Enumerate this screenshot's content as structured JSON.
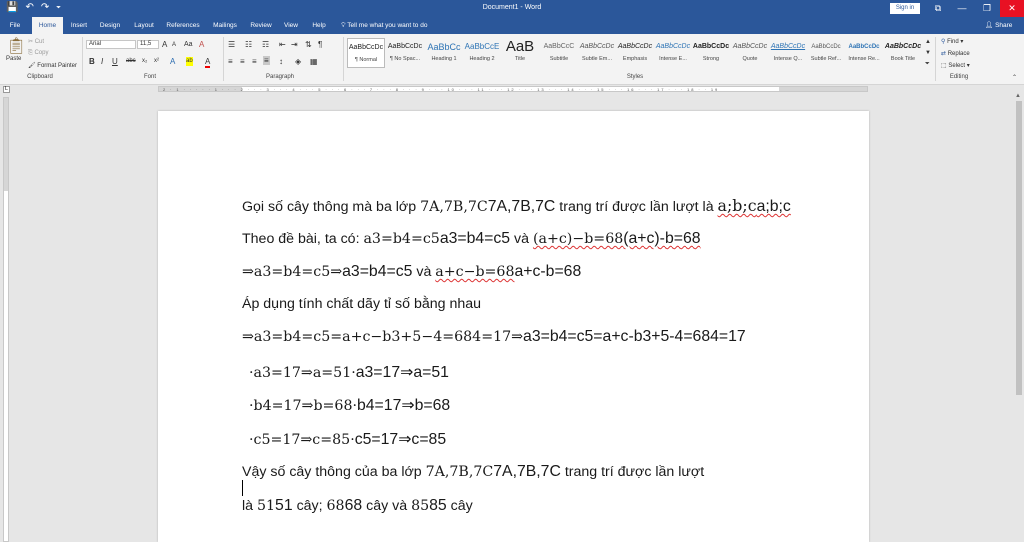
{
  "window": {
    "title": "Document1 - Word",
    "sign_in": "Sign in",
    "share": "Share",
    "qat": [
      "💾",
      "↶",
      "↷",
      "⏷"
    ],
    "controls": [
      "⧉",
      "—",
      "❐",
      "✕"
    ]
  },
  "tabs": [
    "File",
    "Home",
    "Insert",
    "Design",
    "Layout",
    "References",
    "Mailings",
    "Review",
    "View",
    "Help"
  ],
  "tell_me": "Tell me what you want to do",
  "ribbon": {
    "clipboard": {
      "paste": "Paste",
      "cut": "Cut",
      "copy": "Copy",
      "format_painter": "Format Painter",
      "label": "Clipboard"
    },
    "font": {
      "name": "Arial",
      "size": "11,5",
      "label": "Font",
      "grow": "A",
      "shrink": "A",
      "case": "Aa",
      "clear": "A",
      "bold": "B",
      "italic": "I",
      "underline": "U",
      "strike": "abc",
      "sub": "x₂",
      "sup": "x²",
      "effects": "A",
      "highlight": "ab",
      "color": "A"
    },
    "paragraph": {
      "label": "Paragraph",
      "pilcrow": "¶"
    },
    "styles": {
      "label": "Styles",
      "items": [
        {
          "preview": "AaBbCcDc",
          "name": "¶ Normal"
        },
        {
          "preview": "AaBbCcDc",
          "name": "¶ No Spac..."
        },
        {
          "preview": "AaBbCc",
          "name": "Heading 1"
        },
        {
          "preview": "AaBbCcE",
          "name": "Heading 2"
        },
        {
          "preview": "AaB",
          "name": "Title"
        },
        {
          "preview": "AaBbCcC",
          "name": "Subtitle"
        },
        {
          "preview": "AaBbCcDc",
          "name": "Subtle Em..."
        },
        {
          "preview": "AaBbCcDc",
          "name": "Emphasis"
        },
        {
          "preview": "AaBbCcDc",
          "name": "Intense E..."
        },
        {
          "preview": "AaBbCcDc",
          "name": "Strong"
        },
        {
          "preview": "AaBbCcDc",
          "name": "Quote"
        },
        {
          "preview": "AaBbCcDc",
          "name": "Intense Q..."
        },
        {
          "preview": "AaBbCcDc",
          "name": "Subtle Ref..."
        },
        {
          "preview": "AaBbCcDc",
          "name": "Intense Re..."
        },
        {
          "preview": "AaBbCcDc",
          "name": "Book Title"
        }
      ]
    },
    "editing": {
      "label": "Editing",
      "find": "Find",
      "replace": "Replace",
      "select": "Select"
    }
  },
  "ruler": {
    "ticks": "2 · 1 · · · · · 1 · · · 2 · · · 3 · · · 4 · · · 5 · · · 6 · · · 7 · · · 8 · · · 9 · · · 10 · · · 11 · · · 12 · · · 13 · · · 14 · · · 15 · · · 16 · · · 17 · · · 18 · · 19"
  },
  "document": {
    "l1": {
      "a": "Gọi số cây thông mà ba lớp ",
      "m1": "7A,7B,7C",
      "b1": "7A,7B,7C",
      "b": " trang trí được lần lượt là ",
      "m2": "a;b;c",
      "b2": "a;b;c"
    },
    "l2": {
      "a": "Theo đề bài, ta có: ",
      "m1": "a3=b4=c5",
      "b1": "a3=b4=c5",
      "b": " và ",
      "m2": "(a+c)−b=68",
      "b2": "(a+c)-b=68"
    },
    "l3": {
      "m1": "⇒a3=b4=c5⇒",
      "b1": "a3=b4=c5",
      "b": " và ",
      "m2": "a+c−b=68",
      "b2": "a+c-b=68"
    },
    "l4": {
      "a": "Áp dụng tính chất dãy tỉ số bằng nhau"
    },
    "l5": {
      "m1": "⇒a3=b4=c5=a+c−b3+5−4=684=17⇒",
      "b1": "a3=b4=c5=a+c-b3+5-4=684=17"
    },
    "l6": {
      "m1": "·a3=17⇒a=51·",
      "b1": "a3=17⇒a=51"
    },
    "l7": {
      "m1": "·b4=17⇒b=68·",
      "b1": "b4=17⇒b=68"
    },
    "l8": {
      "m1": "·c5=17⇒c=85·",
      "b1": "c5=17⇒c=85"
    },
    "l9": {
      "a": "Vậy số cây thông của ba lớp ",
      "m1": "7A,7B,7C",
      "b1": "7A,7B,7C",
      "b": " trang trí được lần lượt"
    },
    "l10": {
      "a": "là ",
      "m1": "51",
      "b1": "51",
      "b": " cây; ",
      "m2": "68",
      "b2": "68",
      "c": " cây và ",
      "m3": "85",
      "b3": "85",
      "d": " cây"
    }
  }
}
